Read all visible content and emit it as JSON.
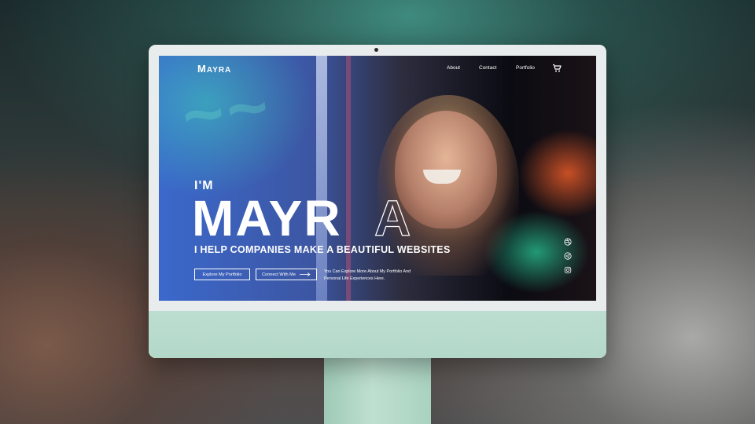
{
  "site": {
    "logo_initial": "M",
    "logo_rest": "AYRA"
  },
  "nav": {
    "items": [
      "About",
      "Contact",
      "Portfolio"
    ],
    "cart_icon": "cart-icon"
  },
  "hero": {
    "intro": "I'M",
    "name_solid": "MAYR",
    "name_outline": "A",
    "tagline": "I HELP COMPANIES MAKE A BEAUTIFUL WEBSITES",
    "button_primary": "Explore My Portfolio",
    "button_secondary": "Connect With Me",
    "description_line1": "You Can Explore More About My Portfolio And",
    "description_line2": "Personal Life Experiences Here."
  },
  "social": {
    "icons": [
      "dribbble-icon",
      "telegram-icon",
      "instagram-icon"
    ]
  },
  "colors": {
    "accent": "#ffffff",
    "stand": "#b3d8c8",
    "bezel": "#e9ecec"
  }
}
